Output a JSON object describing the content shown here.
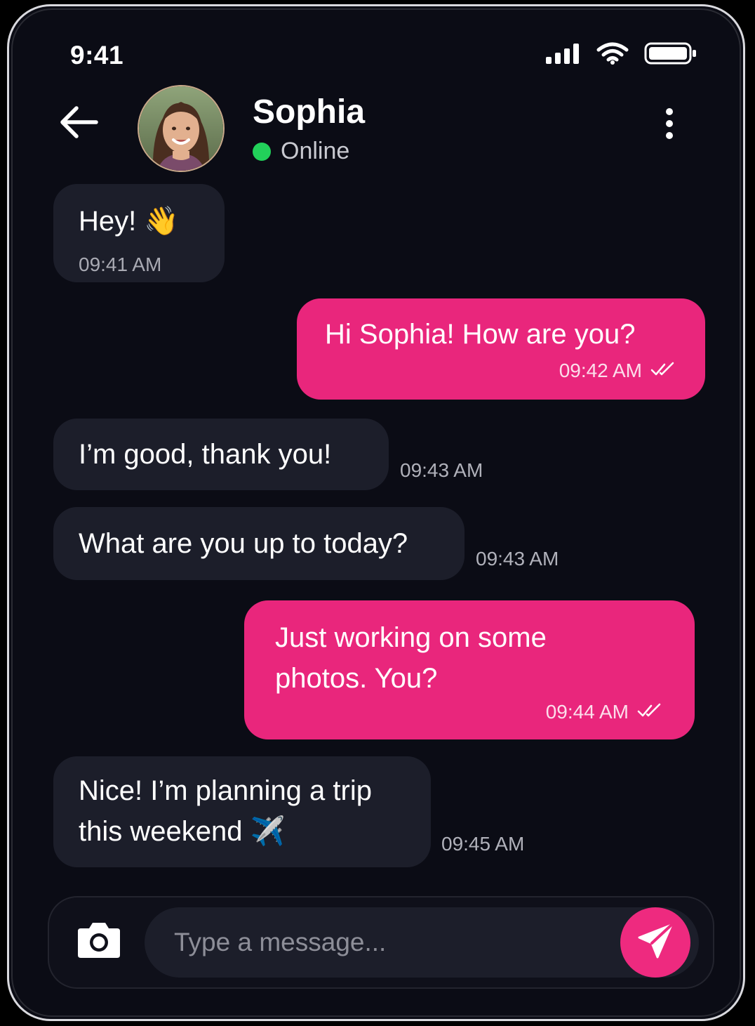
{
  "status_bar": {
    "time": "9:41",
    "icons": [
      "cellular-signal-icon",
      "wifi-icon",
      "battery-icon"
    ]
  },
  "header": {
    "back_icon": "arrow-left-icon",
    "contact_name": "Sophia",
    "presence": "Online",
    "presence_color": "#22d15a",
    "more_icon": "more-vertical-icon"
  },
  "messages": [
    {
      "direction": "in",
      "text": "Hey!",
      "emoji": "👋",
      "time": "09:41 AM"
    },
    {
      "direction": "out",
      "text": "Hi Sophia! How are you?",
      "time": "09:42 AM",
      "status_icon": "double-check-icon"
    },
    {
      "direction": "in",
      "text": "I’m good, thank you!",
      "time": "09:43 AM"
    },
    {
      "direction": "in",
      "text": "What are you up to today?",
      "time": "09:43 AM"
    },
    {
      "direction": "out",
      "text_line1": "Just working on some",
      "text_line2": "photos. You?",
      "time": "09:44 AM",
      "status_icon": "double-check-icon"
    },
    {
      "direction": "in",
      "text_line1": "Nice! I’m planning a trip",
      "text_line2": "this weekend",
      "emoji": "✈️",
      "time": "09:45 AM"
    }
  ],
  "composer": {
    "camera_icon": "camera-icon",
    "placeholder": "Type a message...",
    "send_icon": "send-icon"
  },
  "colors": {
    "background": "#0b0c15",
    "incoming_bubble": "#1c1e2a",
    "outgoing_bubble": "#e9267c",
    "accent": "#ee2a7f"
  }
}
